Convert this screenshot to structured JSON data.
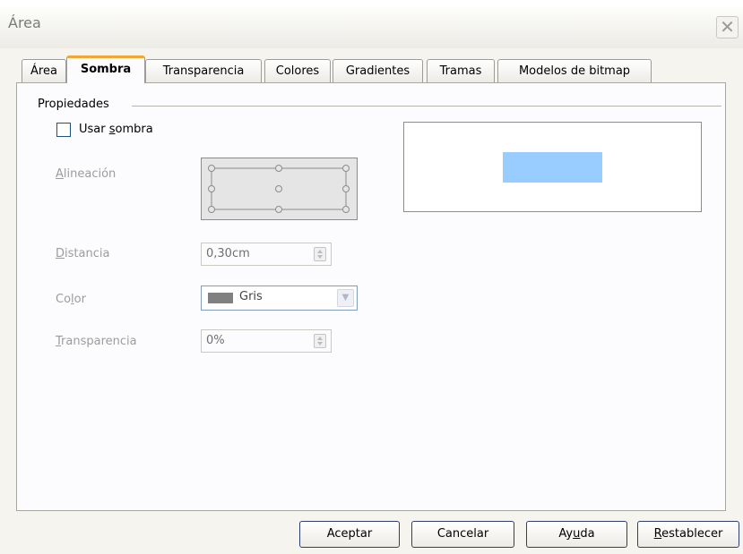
{
  "window": {
    "title": "Área",
    "close_icon": "close-icon"
  },
  "tabs": [
    {
      "label": "Área",
      "active": false
    },
    {
      "label": "Sombra",
      "active": true
    },
    {
      "label": "Transparencia",
      "active": false
    },
    {
      "label": "Colores",
      "active": false
    },
    {
      "label": "Gradientes",
      "active": false
    },
    {
      "label": "Tramas",
      "active": false
    },
    {
      "label": "Modelos de bitmap",
      "active": false
    }
  ],
  "properties": {
    "group_label": "Propiedades",
    "use_shadow": {
      "label_pre": "Usar ",
      "label_mnemonic": "s",
      "label_post": "ombra",
      "checked": false
    },
    "alignment": {
      "label_mnemonic": "A",
      "label_rest": "lineación"
    },
    "distance": {
      "label_mnemonic": "D",
      "label_rest": "istancia",
      "value": "0,30cm"
    },
    "color": {
      "label_pre": "Co",
      "label_mnemonic": "l",
      "label_post": "or",
      "value": "Gris",
      "swatch": "#808080"
    },
    "transparency": {
      "label_mnemonic": "T",
      "label_rest": "ransparencia",
      "value": "0%"
    }
  },
  "preview": {
    "fill": "#99ccff"
  },
  "buttons": {
    "ok": "Aceptar",
    "cancel": "Cancelar",
    "help_pre": "Ay",
    "help_mnemonic": "u",
    "help_post": "da",
    "reset_mnemonic": "R",
    "reset_rest": "establecer"
  }
}
